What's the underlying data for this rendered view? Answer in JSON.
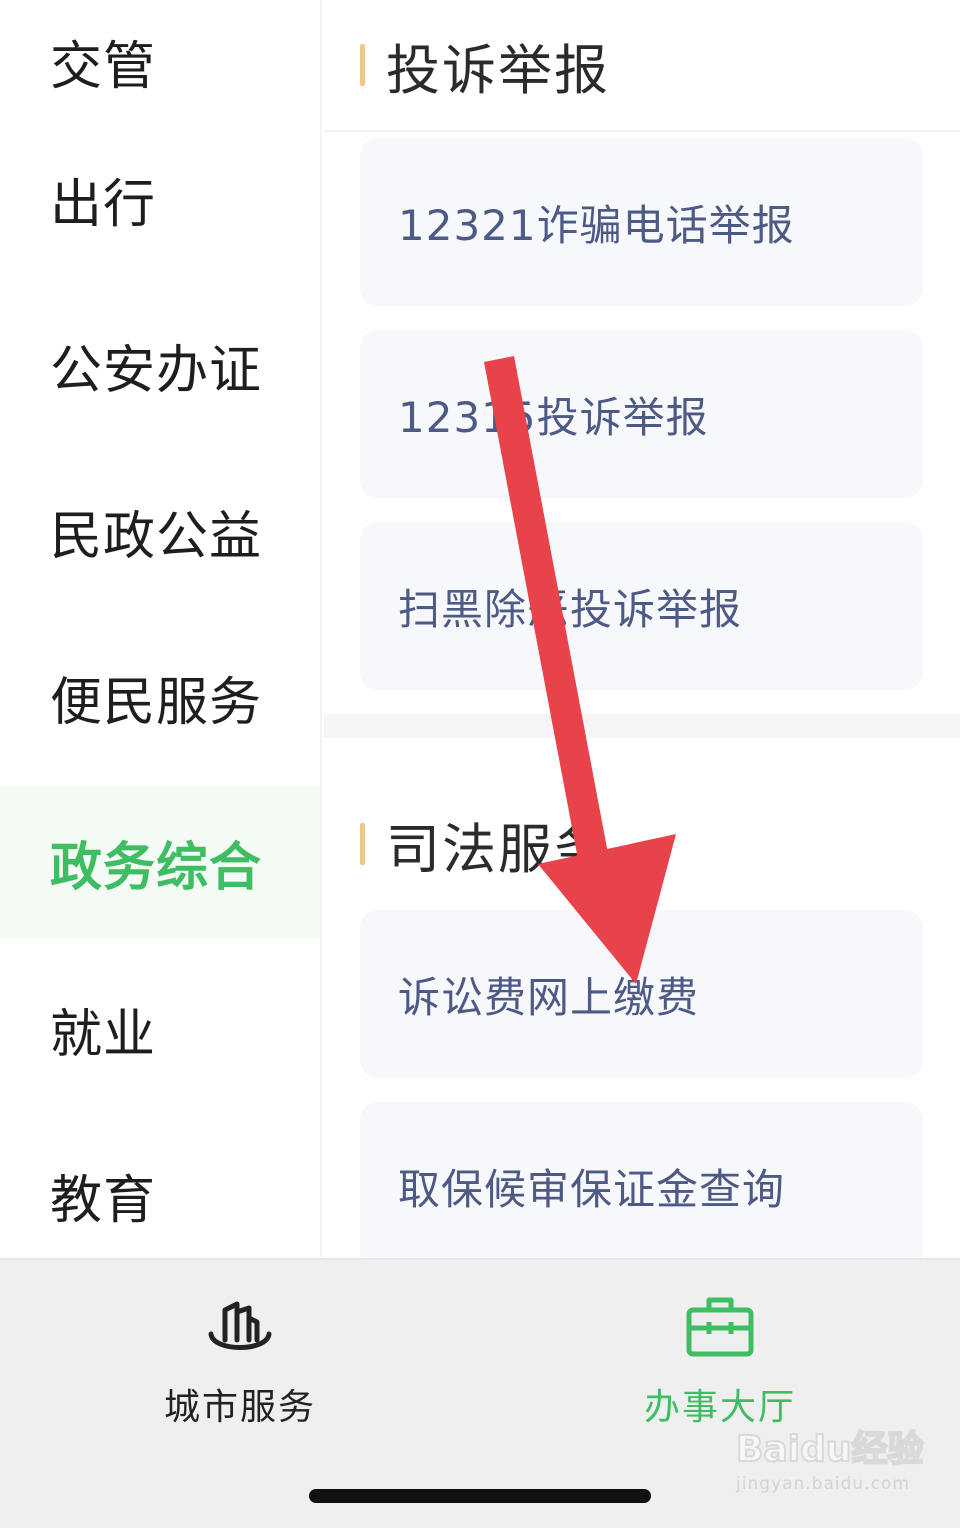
{
  "sidebar": {
    "items": [
      {
        "label": "交管"
      },
      {
        "label": "出行"
      },
      {
        "label": "公安办证"
      },
      {
        "label": "民政公益"
      },
      {
        "label": "便民服务"
      },
      {
        "label": "政务综合",
        "active": true
      },
      {
        "label": "就业"
      },
      {
        "label": "教育"
      }
    ]
  },
  "content": {
    "sections": [
      {
        "title": "投诉举报",
        "items": [
          {
            "label": "12321诈骗电话举报"
          },
          {
            "label": "12315投诉举报"
          },
          {
            "label": "扫黑除恶投诉举报"
          }
        ]
      },
      {
        "title": "司法服务",
        "items": [
          {
            "label": "诉讼费网上缴费"
          },
          {
            "label": "取保候审保证金查询"
          }
        ]
      }
    ]
  },
  "tabbar": {
    "tabs": [
      {
        "label": "城市服务",
        "icon": "city-buildings-icon",
        "active": false
      },
      {
        "label": "办事大厅",
        "icon": "briefcase-icon",
        "active": true
      }
    ]
  },
  "watermark": {
    "logo": "Baidu经验",
    "url": "jingyan.baidu.com"
  },
  "colors": {
    "accent_green": "#3fbd63",
    "section_bar": "#f1c889",
    "card_text": "#4d5a86",
    "card_bg": "#f7f8fc",
    "arrow_red": "#e8424a"
  }
}
